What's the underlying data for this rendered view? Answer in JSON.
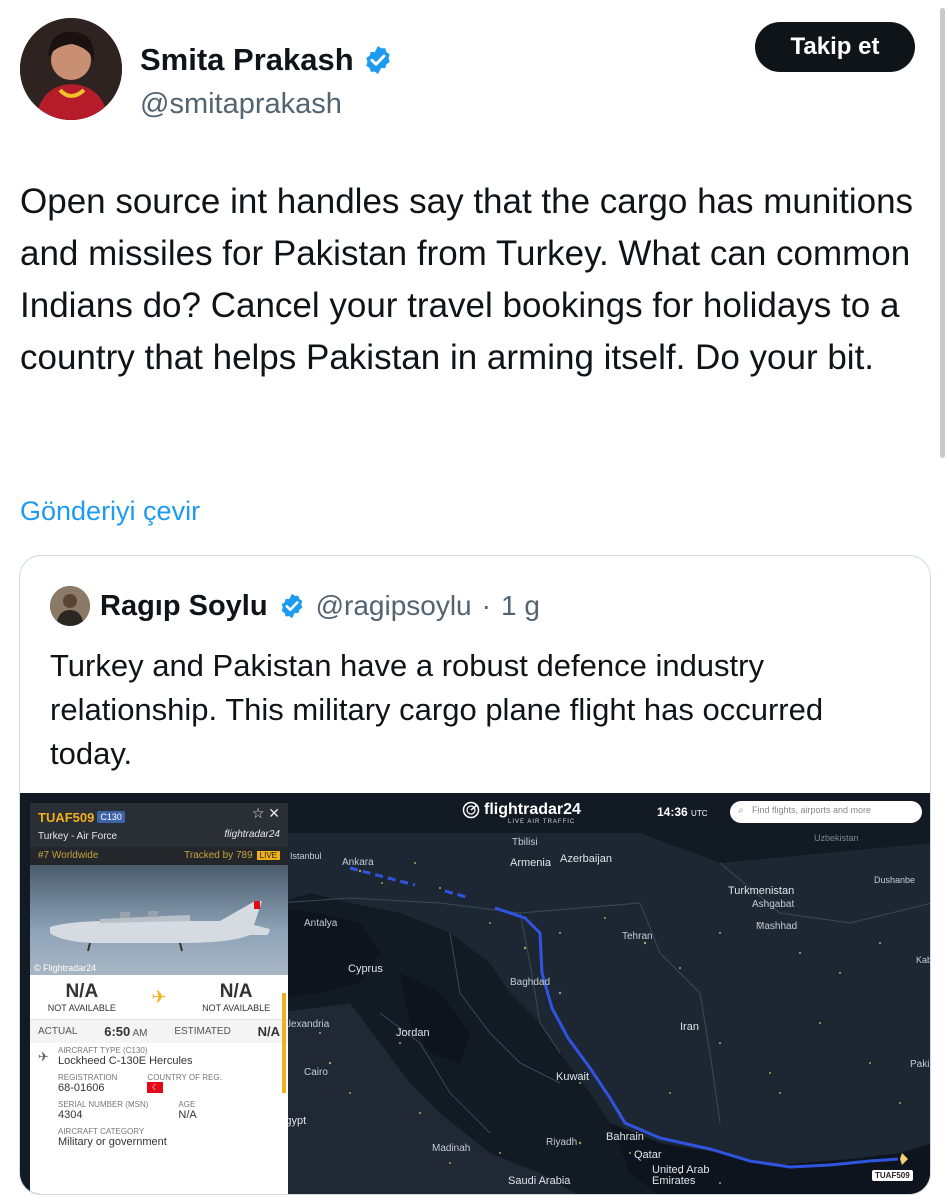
{
  "author": {
    "name": "Smita Prakash",
    "handle": "@smitaprakash",
    "follow_label": "Takip et"
  },
  "tweet": {
    "text": "Open source int handles say that the cargo has munitions and missiles for Pakistan from Turkey. What can common Indians do? Cancel your travel bookings for holidays to a country that helps Pakistan in arming itself. Do your bit.",
    "translate_label": "Gönderiyi çevir"
  },
  "quote": {
    "name": "Ragıp Soylu",
    "handle": "@ragipsoylu",
    "separator": "·",
    "time": "1 g",
    "text": "Turkey and Pakistan have a robust defence industry relationship. This military cargo plane flight has occurred today."
  },
  "flightradar": {
    "callsign": "TUAF509",
    "type_badge": "C130",
    "operator": "Turkey - Air Force",
    "brand": "flightradar24",
    "rank": "#7 Worldwide",
    "tracked": "Tracked by 789",
    "live": "LIVE",
    "photo_credit": "© Flightradar24",
    "origin": "N/A",
    "origin_sub": "NOT AVAILABLE",
    "destination": "N/A",
    "destination_sub": "NOT AVAILABLE",
    "actual_label": "ACTUAL",
    "actual_time": "6:50",
    "actual_suffix": "AM",
    "estimated_label": "ESTIMATED",
    "estimated_value": "N/A",
    "aircraft_type_label": "AIRCRAFT TYPE (C130)",
    "aircraft_type": "Lockheed C-130E Hercules",
    "registration_label": "REGISTRATION",
    "registration": "68-01606",
    "country_label": "COUNTRY OF REG.",
    "serial_label": "SERIAL NUMBER (MSN)",
    "serial": "4304",
    "age_label": "AGE",
    "age": "N/A",
    "category_label": "AIRCRAFT CATEGORY",
    "category": "Military or government",
    "logo": "flightradar24",
    "logo_sub": "LIVE AIR TRAFFIC",
    "time": "14:36",
    "time_zone": "UTC",
    "search_placeholder": "Find flights, airports and more",
    "flight_tag": "TUAF509"
  },
  "map_labels": [
    "Ankara",
    "Antalya",
    "Cyprus",
    "Tbilisi",
    "Armenia",
    "Azerbaijan",
    "Turkmenistan",
    "Ashgabat",
    "Mashhad",
    "Tehran",
    "Baghdad",
    "Iran",
    "Alexandria",
    "Jordan",
    "Cairo",
    "Egypt",
    "Kuwait",
    "Riyadh",
    "Bahrain",
    "Qatar",
    "Madinah",
    "Saudi Arabia",
    "United Arab Emirates",
    "Dushanbe",
    "Kab",
    "Paki",
    "Uzbekistan",
    "Istanbul"
  ],
  "colors": {
    "verified": "#1d9bf0",
    "link": "#1d9bf0",
    "flight_path": "#2f55e0",
    "map_bg": "#121a24"
  }
}
